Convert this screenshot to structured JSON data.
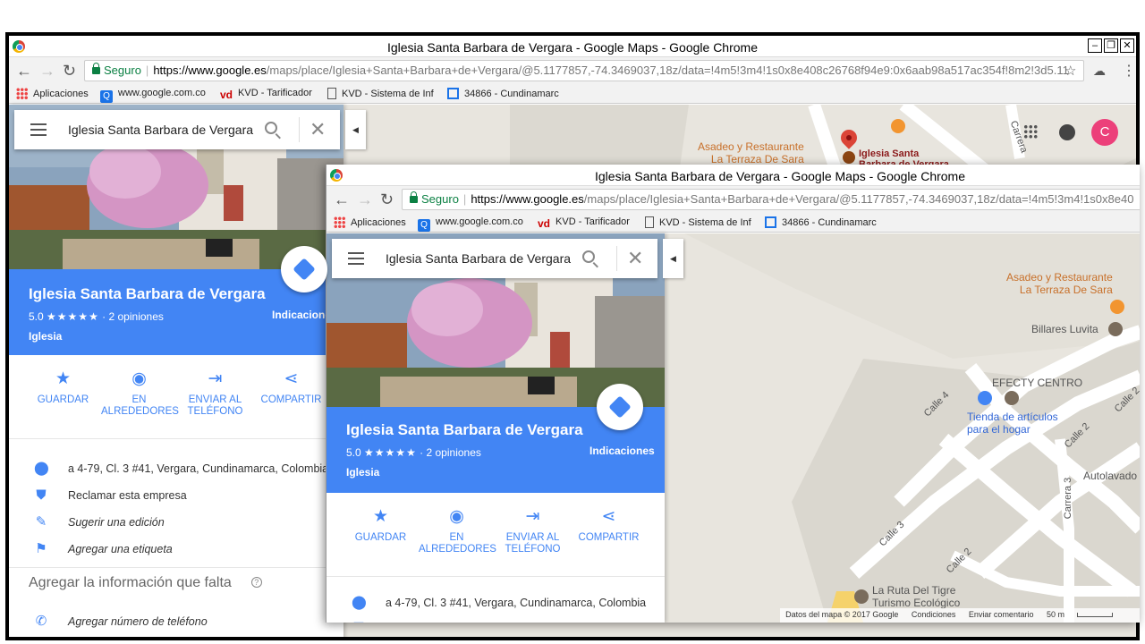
{
  "window": {
    "title": "Iglesia Santa Barbara de Vergara - Google Maps - Google Chrome",
    "controls": {
      "minimize": "–",
      "restore": "❐",
      "close": "✕"
    }
  },
  "browser": {
    "secure_label": "Seguro",
    "url_strong": "https://www.google.es",
    "url_rest_1": "/maps/place/Iglesia+Santa+Barbara+de+Vergara/@5.1177857,-74.3469037,18z/data=!4m5!3m4!1s0x8e408c26768f94e9:0x6aab98a517ac354f!8m2!3d5.11",
    "url_rest_2": "/maps/place/Iglesia+Santa+Barbara+de+Vergara/@5.1177857,-74.3469037,18z/data=!4m5!3m4!1s0x8e40",
    "bookmarks": [
      "Aplicaciones",
      "www.google.com.co",
      "KVD - Tarificador",
      "KVD - Sistema de Inf",
      "34866 - Cundinamarc"
    ]
  },
  "search": {
    "value": "Iglesia Santa Barbara de Vergara"
  },
  "place": {
    "name": "Iglesia Santa Barbara de Vergara",
    "rating": "5.0",
    "stars": "★★★★★",
    "reviews": "· 2 opiniones",
    "category": "Iglesia",
    "directions_label": "Indicaciones"
  },
  "actions": [
    {
      "label_1": "GUARDAR",
      "label_2": ""
    },
    {
      "label_1": "EN",
      "label_2": "ALREDEDORES"
    },
    {
      "label_1": "ENVIAR AL",
      "label_2": "TELÉFONO"
    },
    {
      "label_1": "COMPARTIR",
      "label_2": ""
    }
  ],
  "info": {
    "address": "a 4-79, Cl. 3 #41, Vergara, Cundinamarca, Colombia",
    "claim": "Reclamar esta empresa",
    "suggest": "Sugerir una edición",
    "label": "Agregar una etiqueta",
    "missing_header": "Agregar la información que falta",
    "phone": "Agregar número de teléfono"
  },
  "map": {
    "poi_restaurant_1": "Asadeo y Restaurante",
    "poi_restaurant_2": "La Terraza De Sara",
    "poi_church_1": "Iglesia Santa",
    "poi_church_2": "Barbara de Vergara",
    "poi_billares": "Billares Luvita",
    "poi_efecty": "EFECTY CENTRO",
    "poi_tienda_1": "Tienda de artículos",
    "poi_tienda_2": "para el hogar",
    "poi_autolavado": "Autolavado",
    "poi_ruta_1": "La Ruta Del Tigre",
    "poi_ruta_2": "Turismo Ecológico",
    "streets": [
      "Calle 4",
      "Calle 2",
      "Calle 2",
      "Carrera 3",
      "Calle 3",
      "Calle 2",
      "Carrera"
    ],
    "avatar_letter": "C",
    "footer_data": "Datos del mapa © 2017 Google",
    "footer_terms": "Condiciones",
    "footer_feedback": "Enviar comentario",
    "footer_scale": "50 m"
  }
}
